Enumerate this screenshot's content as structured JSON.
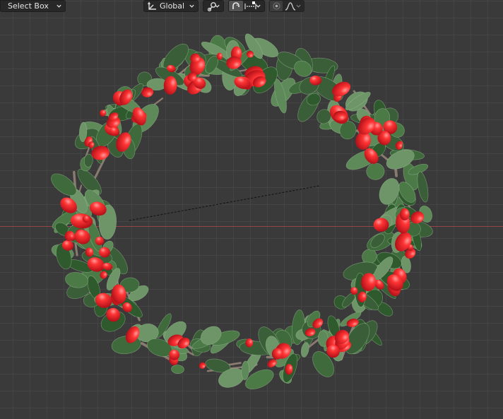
{
  "header": {
    "select_tool": {
      "label": "Select Box",
      "icon": "chevron-down-icon"
    },
    "transform_orientation": {
      "label": "Global",
      "icon": "orientation-axes-icon"
    },
    "pivot_point": {
      "icon": "pivot-chain-link-icon"
    },
    "snapping": {
      "enabled": true,
      "icon": "magnet-icon",
      "target_icon": "snap-increment-icon"
    },
    "proportional_editing": {
      "enabled": false,
      "icon": "proportional-edit-icon",
      "falloff_icon": "smooth-falloff-icon"
    }
  },
  "viewport": {
    "object": "holly berry wreath",
    "colors": {
      "background": "#3a3a3a",
      "grid": "#444444",
      "x_axis": "#a8474f",
      "berry": "#e5262b",
      "leaf": "#3f6b3c",
      "stem": "#8a7b70"
    }
  }
}
